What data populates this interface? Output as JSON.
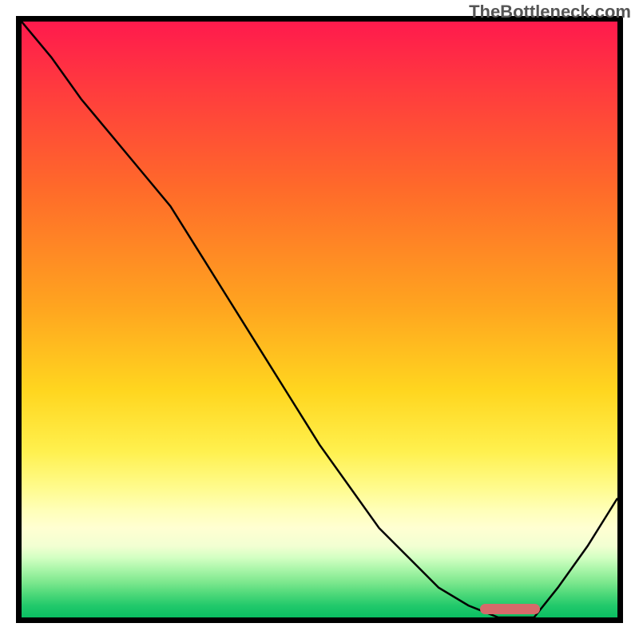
{
  "watermark": "TheBottleneck.com",
  "chart_data": {
    "type": "line",
    "title": "",
    "xlabel": "",
    "ylabel": "",
    "xlim": [
      0,
      100
    ],
    "ylim": [
      0,
      100
    ],
    "background_gradient": {
      "top_color": "#ff1a4d",
      "bottom_color": "#0abf62",
      "description": "red-to-green vertical gradient (bottleneck severity scale)"
    },
    "series": [
      {
        "name": "bottleneck-curve",
        "color": "#000000",
        "x": [
          0,
          5,
          10,
          15,
          20,
          25,
          30,
          35,
          40,
          45,
          50,
          55,
          60,
          65,
          70,
          75,
          80,
          83,
          86,
          90,
          95,
          100
        ],
        "y": [
          100,
          94,
          87,
          81,
          75,
          69,
          61,
          53,
          45,
          37,
          29,
          22,
          15,
          10,
          5,
          2,
          0,
          0,
          0,
          5,
          12,
          20
        ]
      }
    ],
    "highlight_marker": {
      "x_start": 77,
      "x_end": 87,
      "y": 1.5,
      "color": "#d66a6a",
      "shape": "rounded-bar"
    }
  }
}
